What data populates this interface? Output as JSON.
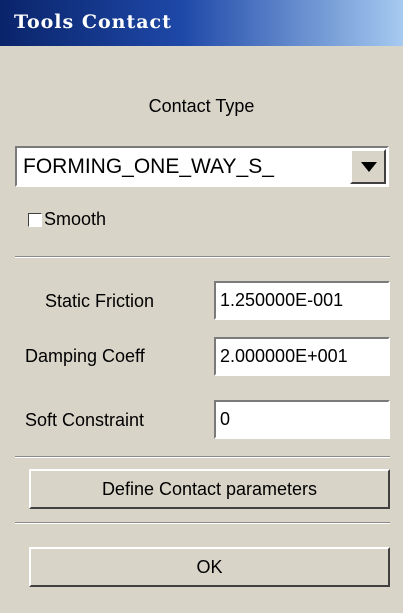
{
  "window": {
    "title": "Tools Contact"
  },
  "contact_type": {
    "label": "Contact Type",
    "selected": "FORMING_ONE_WAY_S_"
  },
  "smooth": {
    "label": "Smooth",
    "checked": false
  },
  "fields": [
    {
      "label": "Static Friction",
      "value": "1.250000E-001"
    },
    {
      "label": "Damping Coeff",
      "value": "2.000000E+001"
    },
    {
      "label": "Soft Constraint",
      "value": "0"
    }
  ],
  "buttons": {
    "define": "Define Contact parameters",
    "ok": "OK"
  }
}
